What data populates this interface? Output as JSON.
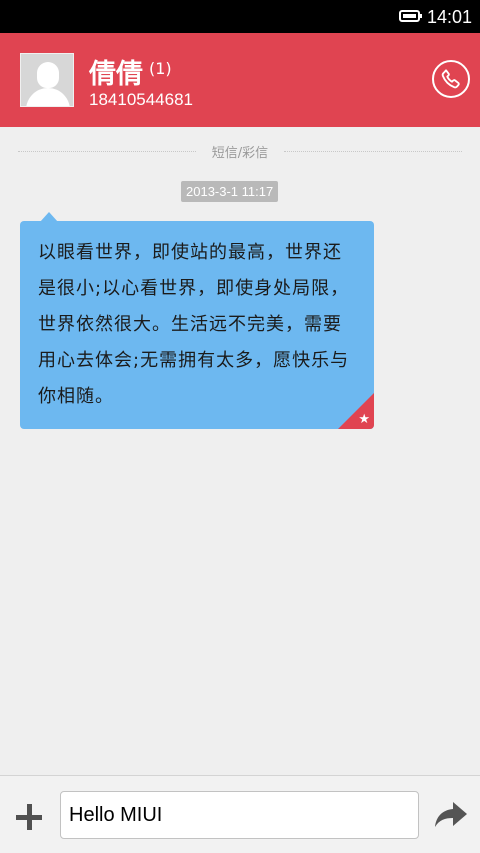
{
  "status_bar": {
    "time": "14:01"
  },
  "header": {
    "contact_name": "倩倩",
    "message_count": "(1)",
    "phone_number": "18410544681"
  },
  "conversation": {
    "type_label": "短信/彩信",
    "timestamp": "2013-3-1 11:17",
    "message_text": "以眼看世界，即使站的最高，世界还是很小;以心看世界，即使身处局限，世界依然很大。生活远不完美，需要用心去体会;无需拥有太多，愿快乐与你相随。"
  },
  "composer": {
    "input_value": "Hello MIUI"
  },
  "colors": {
    "header_bg": "#e04451",
    "bubble_bg": "#6db8f0",
    "status_bar_bg": "#000000"
  },
  "icons": [
    "battery-icon",
    "avatar-icon",
    "phone-icon",
    "star-icon",
    "plus-icon",
    "send-icon"
  ]
}
